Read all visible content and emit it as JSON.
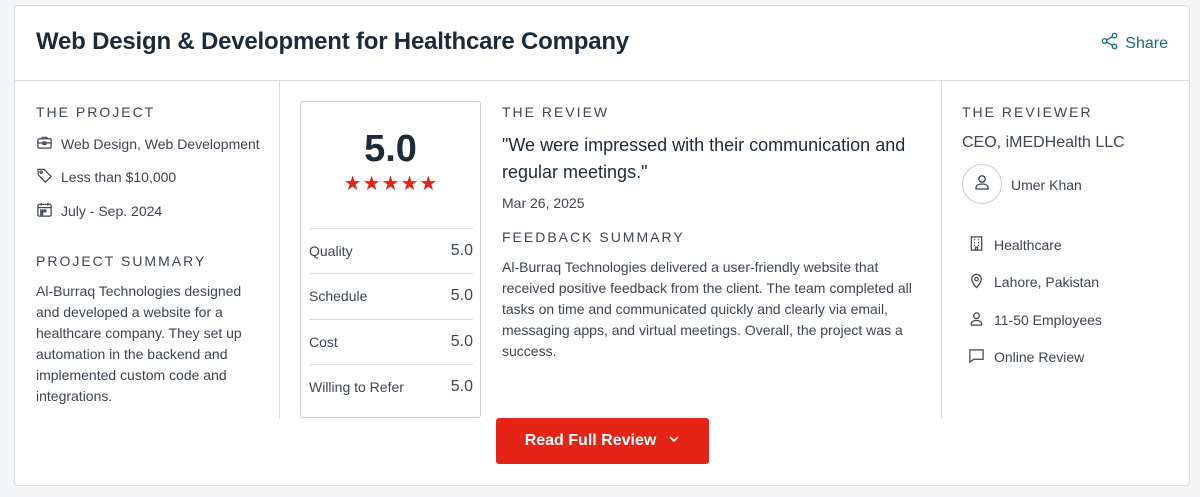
{
  "header": {
    "title": "Web Design & Development for Healthcare Company",
    "share_label": "Share"
  },
  "project": {
    "section_label": "THE PROJECT",
    "services": "Web Design, Web Development",
    "budget": "Less than $10,000",
    "timeline": "July - Sep. 2024",
    "summary_label": "PROJECT SUMMARY",
    "summary_lines": [
      "Al-Burraq Technologies designed",
      "and developed a website for a",
      "healthcare company. They set up",
      "automation in the backend and",
      "implemented custom code and",
      "integrations."
    ]
  },
  "rating": {
    "overall": "5.0",
    "stars": 5,
    "rows": [
      {
        "label": "Quality",
        "value": "5.0"
      },
      {
        "label": "Schedule",
        "value": "5.0"
      },
      {
        "label": "Cost",
        "value": "5.0"
      },
      {
        "label": "Willing to Refer",
        "value": "5.0"
      }
    ]
  },
  "review": {
    "section_label": "THE REVIEW",
    "quote_lines": [
      "\"We were impressed with their communication and",
      "regular meetings.\""
    ],
    "date": "Mar 26, 2025",
    "feedback_label": "FEEDBACK SUMMARY",
    "feedback_lines": [
      "Al-Burraq Technologies delivered a user-friendly website that",
      "received positive feedback from the client. The team completed all",
      "tasks on time and communicated quickly and clearly via email,",
      "messaging apps, and virtual meetings. Overall, the project was a",
      "success."
    ]
  },
  "reviewer": {
    "section_label": "THE REVIEWER",
    "role": "CEO, iMEDHealth LLC",
    "name": "Umer Khan",
    "industry": "Healthcare",
    "location": "Lahore, Pakistan",
    "size": "11-50 Employees",
    "review_type": "Online Review"
  },
  "cta": {
    "label": "Read Full Review"
  },
  "colors": {
    "accent": "#e62415",
    "link": "#17688c",
    "title": "#1c2a3a",
    "border": "#d9dcdf"
  }
}
